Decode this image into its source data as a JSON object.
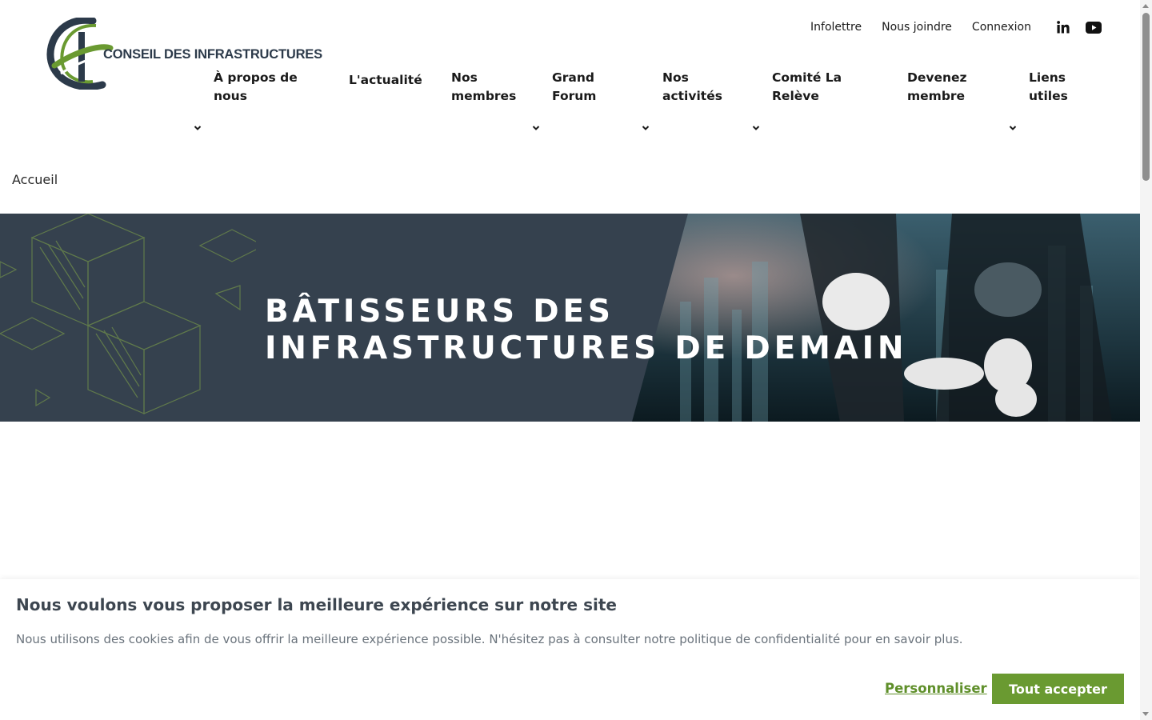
{
  "header": {
    "logo_text": "CONSEIL DES INFRASTRUCTURES",
    "top_links": [
      "Infolettre",
      "Nous joindre",
      "Connexion"
    ],
    "social_icons": [
      "linkedin-icon",
      "youtube-icon"
    ]
  },
  "nav": {
    "items": [
      {
        "label_line1": "À propos de",
        "label_line2": "nous",
        "has_dropdown": true
      },
      {
        "label_line1": "L'actualité",
        "label_line2": "",
        "has_dropdown": false
      },
      {
        "label_line1": "Nos",
        "label_line2": "membres",
        "has_dropdown": true
      },
      {
        "label_line1": "Grand",
        "label_line2": "Forum",
        "has_dropdown": true
      },
      {
        "label_line1": "Nos",
        "label_line2": "activités",
        "has_dropdown": true
      },
      {
        "label_line1": "Comité La",
        "label_line2": "Relève",
        "has_dropdown": false
      },
      {
        "label_line1": "Devenez",
        "label_line2": "membre",
        "has_dropdown": true
      },
      {
        "label_line1": "Liens",
        "label_line2": "utiles",
        "has_dropdown": false
      }
    ]
  },
  "breadcrumb": {
    "current": "Accueil"
  },
  "hero": {
    "title_line1": "BÂTISSEURS DES",
    "title_line2": "INFRASTRUCTURES DE DEMAIN"
  },
  "cookie_banner": {
    "title": "Nous voulons vous proposer la meilleure expérience sur notre site",
    "text": "Nous utilisons des cookies afin de vous offrir la meilleure expérience possible. N'hésitez pas à consulter notre politique de confidentialité pour en savoir plus.",
    "customize_label": "Personnaliser",
    "accept_label": "Tout accepter"
  },
  "colors": {
    "brand_green": "#6a9a31",
    "brand_dark": "#2c3a4a",
    "hero_bg": "#35414e"
  }
}
